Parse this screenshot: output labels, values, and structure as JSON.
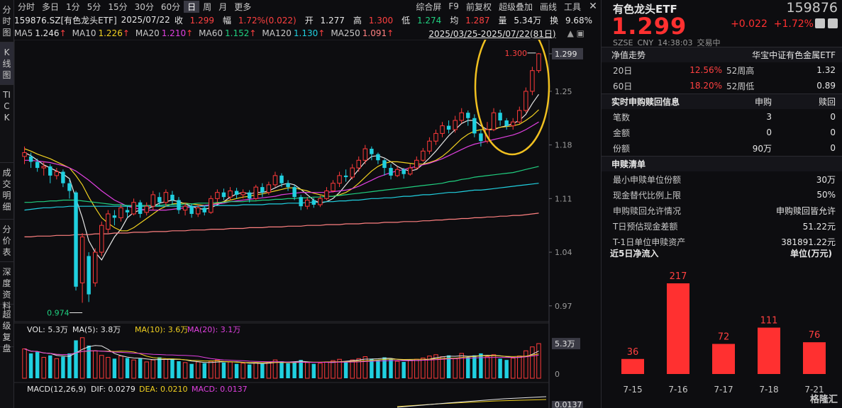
{
  "leftnav": [
    "分时图",
    "K线图",
    "TICK",
    "成交明细",
    "分价表",
    "深度资料",
    "超级复盘"
  ],
  "toolbar": {
    "left": [
      "分时",
      "多日",
      "1分",
      "5分",
      "15分",
      "30分",
      "60分",
      "日",
      "周",
      "月",
      "更多"
    ],
    "active": "日",
    "right": [
      "综合屏",
      "F9",
      "前复权",
      "超级叠加",
      "画线",
      "工具"
    ]
  },
  "info": {
    "code_name": "159876.SZ[有色龙头ETF]",
    "date": "2025/07/22",
    "close_label": "收",
    "close": "1.299",
    "amp_label": "幅",
    "amp": "1.72%(0.022)",
    "open_label": "开",
    "open": "1.277",
    "high_label": "高",
    "high": "1.300",
    "low_label": "低",
    "low": "1.274",
    "avg_label": "均",
    "avg": "1.287",
    "vol_label": "量",
    "vol": "5.34万",
    "turnover_label": "换",
    "turnover": "9.68%"
  },
  "ma": [
    {
      "label": "MA5",
      "value": "1.246",
      "color": "#e6e6e6"
    },
    {
      "label": "MA10",
      "value": "1.226",
      "color": "#f0d020"
    },
    {
      "label": "MA20",
      "value": "1.210",
      "color": "#e040e0"
    },
    {
      "label": "MA60",
      "value": "1.152",
      "color": "#20d080"
    },
    {
      "label": "MA120",
      "value": "1.130",
      "color": "#20d0e0"
    },
    {
      "label": "MA250",
      "value": "1.091",
      "color": "#ff8080"
    }
  ],
  "range_label": "2025/03/25-2025/07/22(81日)",
  "chart_data": {
    "type": "candlestick",
    "yticks": [
      1.299,
      1.25,
      1.18,
      1.11,
      1.04,
      0.97
    ],
    "high_marker": "1.300",
    "low_marker": "0.974",
    "last_price": "1.299",
    "candles": [
      [
        1.165,
        1.17,
        1.155,
        1.178
      ],
      [
        1.165,
        1.158,
        1.15,
        1.17
      ],
      [
        1.158,
        1.15,
        1.145,
        1.162
      ],
      [
        1.15,
        1.152,
        1.14,
        1.158
      ],
      [
        1.152,
        1.14,
        1.13,
        1.155
      ],
      [
        1.14,
        1.145,
        1.135,
        1.15
      ],
      [
        1.145,
        1.13,
        1.125,
        1.148
      ],
      [
        1.13,
        1.12,
        1.11,
        1.135
      ],
      [
        1.118,
        0.995,
        0.99,
        1.12
      ],
      [
        1.0,
        1.06,
        0.974,
        1.065
      ],
      [
        1.035,
        0.985,
        0.975,
        1.04
      ],
      [
        1.0,
        1.04,
        0.995,
        1.045
      ],
      [
        1.04,
        1.075,
        1.035,
        1.08
      ],
      [
        1.07,
        1.09,
        1.065,
        1.095
      ],
      [
        1.088,
        1.085,
        1.075,
        1.095
      ],
      [
        1.085,
        1.098,
        1.08,
        1.102
      ],
      [
        1.095,
        1.092,
        1.085,
        1.1
      ],
      [
        1.09,
        1.105,
        1.088,
        1.11
      ],
      [
        1.105,
        1.09,
        1.085,
        1.108
      ],
      [
        1.092,
        1.1,
        1.088,
        1.105
      ],
      [
        1.1,
        1.115,
        1.095,
        1.12
      ],
      [
        1.112,
        1.105,
        1.1,
        1.118
      ],
      [
        1.105,
        1.118,
        1.1,
        1.122
      ],
      [
        1.115,
        1.108,
        1.102,
        1.12
      ],
      [
        1.108,
        1.095,
        1.09,
        1.112
      ],
      [
        1.095,
        1.1,
        1.088,
        1.104
      ],
      [
        1.1,
        1.09,
        1.085,
        1.103
      ],
      [
        1.09,
        1.098,
        1.086,
        1.102
      ],
      [
        1.098,
        1.092,
        1.088,
        1.101
      ],
      [
        1.092,
        1.11,
        1.09,
        1.114
      ],
      [
        1.11,
        1.118,
        1.105,
        1.122
      ],
      [
        1.118,
        1.112,
        1.108,
        1.123
      ],
      [
        1.112,
        1.12,
        1.108,
        1.125
      ],
      [
        1.12,
        1.115,
        1.11,
        1.124
      ],
      [
        1.115,
        1.118,
        1.11,
        1.122
      ],
      [
        1.118,
        1.11,
        1.105,
        1.121
      ],
      [
        1.11,
        1.125,
        1.108,
        1.128
      ],
      [
        1.125,
        1.118,
        1.112,
        1.13
      ],
      [
        1.118,
        1.128,
        1.115,
        1.132
      ],
      [
        1.128,
        1.14,
        1.125,
        1.145
      ],
      [
        1.14,
        1.13,
        1.125,
        1.143
      ],
      [
        1.13,
        1.125,
        1.12,
        1.134
      ],
      [
        1.125,
        1.112,
        1.108,
        1.128
      ],
      [
        1.112,
        1.1,
        1.095,
        1.115
      ],
      [
        1.1,
        1.108,
        1.096,
        1.112
      ],
      [
        1.108,
        1.102,
        1.098,
        1.111
      ],
      [
        1.102,
        1.11,
        1.099,
        1.114
      ],
      [
        1.11,
        1.12,
        1.108,
        1.125
      ],
      [
        1.12,
        1.13,
        1.118,
        1.134
      ],
      [
        1.13,
        1.14,
        1.125,
        1.145
      ],
      [
        1.14,
        1.138,
        1.132,
        1.148
      ],
      [
        1.138,
        1.15,
        1.135,
        1.155
      ],
      [
        1.15,
        1.16,
        1.145,
        1.165
      ],
      [
        1.16,
        1.175,
        1.155,
        1.18
      ],
      [
        1.175,
        1.168,
        1.16,
        1.178
      ],
      [
        1.168,
        1.16,
        1.155,
        1.17
      ],
      [
        1.16,
        1.15,
        1.14,
        1.162
      ],
      [
        1.15,
        1.14,
        1.135,
        1.155
      ],
      [
        1.14,
        1.148,
        1.138,
        1.152
      ],
      [
        1.148,
        1.142,
        1.136,
        1.15
      ],
      [
        1.142,
        1.15,
        1.14,
        1.155
      ],
      [
        1.15,
        1.16,
        1.148,
        1.165
      ],
      [
        1.16,
        1.172,
        1.158,
        1.176
      ],
      [
        1.172,
        1.185,
        1.168,
        1.19
      ],
      [
        1.185,
        1.195,
        1.18,
        1.2
      ],
      [
        1.195,
        1.205,
        1.19,
        1.21
      ],
      [
        1.205,
        1.2,
        1.195,
        1.212
      ],
      [
        1.2,
        1.212,
        1.196,
        1.218
      ],
      [
        1.212,
        1.222,
        1.208,
        1.228
      ],
      [
        1.222,
        1.215,
        1.205,
        1.225
      ],
      [
        1.215,
        1.195,
        1.19,
        1.22
      ],
      [
        1.195,
        1.185,
        1.178,
        1.2
      ],
      [
        1.185,
        1.2,
        1.182,
        1.21
      ],
      [
        1.2,
        1.222,
        1.198,
        1.228
      ],
      [
        1.222,
        1.212,
        1.205,
        1.226
      ],
      [
        1.212,
        1.205,
        1.2,
        1.215
      ],
      [
        1.205,
        1.21,
        1.2,
        1.215
      ],
      [
        1.21,
        1.225,
        1.208,
        1.23
      ],
      [
        1.225,
        1.25,
        1.222,
        1.255
      ],
      [
        1.25,
        1.277,
        1.245,
        1.282
      ],
      [
        1.277,
        1.299,
        1.274,
        1.3
      ]
    ],
    "ma_lines": {
      "MA5": [
        1.17,
        1.166,
        1.16,
        1.154,
        1.15,
        1.146,
        1.142,
        1.136,
        1.11,
        1.085,
        1.055,
        1.04,
        1.03,
        1.045,
        1.06,
        1.07,
        1.085,
        1.092,
        1.095,
        1.096,
        1.1,
        1.104,
        1.106,
        1.108,
        1.106,
        1.103,
        1.1,
        1.097,
        1.096,
        1.098,
        1.102,
        1.106,
        1.112,
        1.116,
        1.118,
        1.116,
        1.118,
        1.118,
        1.12,
        1.124,
        1.128,
        1.13,
        1.128,
        1.122,
        1.115,
        1.108,
        1.104,
        1.106,
        1.11,
        1.118,
        1.128,
        1.138,
        1.148,
        1.158,
        1.165,
        1.166,
        1.163,
        1.158,
        1.152,
        1.148,
        1.146,
        1.148,
        1.155,
        1.163,
        1.172,
        1.182,
        1.192,
        1.2,
        1.208,
        1.212,
        1.212,
        1.205,
        1.2,
        1.2,
        1.203,
        1.205,
        1.208,
        1.212,
        1.22,
        1.234,
        1.246
      ],
      "MA10": [
        1.175,
        1.172,
        1.168,
        1.165,
        1.162,
        1.158,
        1.154,
        1.15,
        1.14,
        1.128,
        1.112,
        1.098,
        1.085,
        1.078,
        1.072,
        1.068,
        1.068,
        1.072,
        1.078,
        1.084,
        1.09,
        1.096,
        1.1,
        1.103,
        1.104,
        1.104,
        1.103,
        1.102,
        1.101,
        1.102,
        1.104,
        1.106,
        1.108,
        1.11,
        1.112,
        1.113,
        1.115,
        1.116,
        1.118,
        1.12,
        1.122,
        1.124,
        1.124,
        1.122,
        1.12,
        1.117,
        1.115,
        1.113,
        1.113,
        1.115,
        1.118,
        1.123,
        1.13,
        1.138,
        1.146,
        1.152,
        1.156,
        1.158,
        1.158,
        1.157,
        1.156,
        1.155,
        1.155,
        1.157,
        1.16,
        1.165,
        1.172,
        1.18,
        1.188,
        1.194,
        1.198,
        1.2,
        1.2,
        1.201,
        1.203,
        1.204,
        1.205,
        1.207,
        1.212,
        1.218,
        1.226
      ],
      "MA20": [
        1.16,
        1.16,
        1.159,
        1.158,
        1.157,
        1.155,
        1.153,
        1.15,
        1.146,
        1.14,
        1.134,
        1.127,
        1.12,
        1.114,
        1.108,
        1.104,
        1.1,
        1.098,
        1.096,
        1.095,
        1.095,
        1.095,
        1.095,
        1.096,
        1.097,
        1.098,
        1.099,
        1.1,
        1.101,
        1.102,
        1.103,
        1.104,
        1.106,
        1.107,
        1.108,
        1.109,
        1.11,
        1.111,
        1.112,
        1.113,
        1.115,
        1.116,
        1.117,
        1.118,
        1.118,
        1.118,
        1.118,
        1.118,
        1.119,
        1.12,
        1.121,
        1.123,
        1.126,
        1.13,
        1.134,
        1.138,
        1.141,
        1.144,
        1.146,
        1.148,
        1.15,
        1.152,
        1.154,
        1.156,
        1.159,
        1.162,
        1.166,
        1.17,
        1.174,
        1.178,
        1.181,
        1.183,
        1.185,
        1.187,
        1.189,
        1.191,
        1.193,
        1.196,
        1.2,
        1.205,
        1.21
      ],
      "MA60": [
        1.105,
        1.105,
        1.106,
        1.106,
        1.107,
        1.107,
        1.108,
        1.108,
        1.108,
        1.107,
        1.106,
        1.105,
        1.104,
        1.103,
        1.102,
        1.102,
        1.101,
        1.101,
        1.101,
        1.101,
        1.101,
        1.101,
        1.102,
        1.102,
        1.102,
        1.103,
        1.103,
        1.104,
        1.104,
        1.104,
        1.105,
        1.105,
        1.106,
        1.106,
        1.106,
        1.107,
        1.107,
        1.108,
        1.108,
        1.109,
        1.109,
        1.11,
        1.11,
        1.111,
        1.111,
        1.112,
        1.112,
        1.113,
        1.113,
        1.114,
        1.115,
        1.116,
        1.117,
        1.118,
        1.119,
        1.12,
        1.121,
        1.122,
        1.123,
        1.124,
        1.125,
        1.126,
        1.127,
        1.128,
        1.129,
        1.13,
        1.132,
        1.133,
        1.135,
        1.136,
        1.138,
        1.139,
        1.14,
        1.141,
        1.142,
        1.143,
        1.144,
        1.146,
        1.148,
        1.15,
        1.152
      ],
      "MA120": [
        1.095,
        1.096,
        1.097,
        1.098,
        1.098,
        1.099,
        1.099,
        1.1,
        1.1,
        1.1,
        1.1,
        1.1,
        1.1,
        1.1,
        1.1,
        1.1,
        1.1,
        1.1,
        1.1,
        1.1,
        1.1,
        1.1,
        1.1,
        1.1,
        1.1,
        1.1,
        1.1,
        1.1,
        1.1,
        1.101,
        1.101,
        1.101,
        1.101,
        1.101,
        1.102,
        1.102,
        1.102,
        1.102,
        1.103,
        1.103,
        1.103,
        1.104,
        1.104,
        1.104,
        1.105,
        1.105,
        1.105,
        1.106,
        1.106,
        1.107,
        1.107,
        1.108,
        1.108,
        1.109,
        1.11,
        1.11,
        1.111,
        1.111,
        1.112,
        1.113,
        1.113,
        1.114,
        1.115,
        1.115,
        1.116,
        1.117,
        1.118,
        1.118,
        1.119,
        1.12,
        1.121,
        1.121,
        1.122,
        1.123,
        1.124,
        1.125,
        1.126,
        1.127,
        1.128,
        1.129,
        1.13
      ],
      "MA250": [
        1.06,
        1.06,
        1.061,
        1.061,
        1.061,
        1.062,
        1.062,
        1.062,
        1.063,
        1.063,
        1.063,
        1.064,
        1.064,
        1.064,
        1.065,
        1.065,
        1.065,
        1.066,
        1.066,
        1.066,
        1.067,
        1.067,
        1.067,
        1.068,
        1.068,
        1.068,
        1.069,
        1.069,
        1.069,
        1.07,
        1.07,
        1.07,
        1.071,
        1.071,
        1.071,
        1.072,
        1.072,
        1.072,
        1.073,
        1.073,
        1.073,
        1.074,
        1.074,
        1.074,
        1.075,
        1.075,
        1.075,
        1.076,
        1.076,
        1.076,
        1.077,
        1.077,
        1.077,
        1.078,
        1.078,
        1.078,
        1.079,
        1.079,
        1.079,
        1.08,
        1.08,
        1.08,
        1.081,
        1.081,
        1.082,
        1.082,
        1.083,
        1.083,
        1.084,
        1.084,
        1.085,
        1.085,
        1.086,
        1.086,
        1.087,
        1.087,
        1.088,
        1.088,
        1.089,
        1.09,
        1.091
      ]
    },
    "volume": {
      "label": "VOL: 5.3万",
      "ma5": "MA(5): 3.8万",
      "ma10": "MA(10): 3.6万",
      "ma20": "MA(20): 3.1万",
      "last": "5.3万",
      "zero": "0",
      "values": [
        4.5,
        3.8,
        4.0,
        3.2,
        3.5,
        3.0,
        3.3,
        3.8,
        5.8,
        6.2,
        5.0,
        4.2,
        3.5,
        3.2,
        3.0,
        3.4,
        3.1,
        2.8,
        3.0,
        2.5,
        2.8,
        3.2,
        2.9,
        3.0,
        2.6,
        2.4,
        2.2,
        2.5,
        2.3,
        2.6,
        2.8,
        2.4,
        2.5,
        2.2,
        2.3,
        2.1,
        2.4,
        2.2,
        2.5,
        2.8,
        2.6,
        2.3,
        2.5,
        2.8,
        2.4,
        2.2,
        2.3,
        2.5,
        2.7,
        2.9,
        2.6,
        2.8,
        3.0,
        3.3,
        3.0,
        2.8,
        3.2,
        2.9,
        2.6,
        2.5,
        2.7,
        2.9,
        3.1,
        3.4,
        3.6,
        3.3,
        3.5,
        3.0,
        3.8,
        3.2,
        3.5,
        3.8,
        3.3,
        3.6,
        3.0,
        2.8,
        3.1,
        3.4,
        4.2,
        4.8,
        5.3
      ]
    },
    "macd": {
      "label": "MACD(12,26,9)",
      "dif": "DIF: 0.0279",
      "dea": "DEA: 0.0210",
      "macd": "MACD: 0.0137",
      "last": "0.0137"
    }
  },
  "right": {
    "title": "有色龙头ETF",
    "code": "159876",
    "price": "1.299",
    "change": "+0.022",
    "pct": "+1.72%",
    "sub": [
      "SZSE",
      "CNY",
      "14:38:03",
      "交易中"
    ],
    "nav_label": "净值走势",
    "nav_name": "华宝中证有色金属ETF",
    "rows1": [
      {
        "a": "20日",
        "b": "12.56%",
        "c": "52周高",
        "d": "1.32"
      },
      {
        "a": "60日",
        "b": "18.20%",
        "c": "52周低",
        "d": "0.89"
      }
    ],
    "sub_head": {
      "a": "实时申购赎回信息",
      "b": "申购",
      "c": "赎回"
    },
    "rows2": [
      {
        "a": "笔数",
        "b": "3",
        "c": "0"
      },
      {
        "a": "金额",
        "b": "0",
        "c": "0"
      },
      {
        "a": "份额",
        "b": "90万",
        "c": "0"
      }
    ],
    "list_head": "申赎清单",
    "rows3": [
      {
        "a": "最小申赎单位份额",
        "b": "30万"
      },
      {
        "a": "现金替代比例上限",
        "b": "50%"
      },
      {
        "a": "申购赎回允许情况",
        "b": "申购赎回皆允许"
      },
      {
        "a": "T日预估现金差额",
        "b": "51.22元"
      },
      {
        "a": "T-1日单位申赎资产",
        "b": "381891.22元"
      }
    ],
    "flow_title": "近5日净流入",
    "flow_unit": "单位(万元)",
    "flow": {
      "categories": [
        "7-15",
        "7-16",
        "7-17",
        "7-18",
        "7-21"
      ],
      "values": [
        36,
        217,
        72,
        111,
        76
      ]
    },
    "watermark": "格隆汇"
  }
}
